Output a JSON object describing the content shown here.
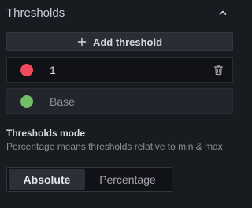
{
  "section": {
    "title": "Thresholds",
    "collapse_icon": "chevron-up-icon"
  },
  "add_button": {
    "label": "Add threshold",
    "icon": "plus-icon"
  },
  "thresholds": [
    {
      "color": "#f2495c",
      "value": "1",
      "deletable": true,
      "delete_icon": "trash-icon"
    },
    {
      "color": "#73bf69",
      "value": "Base",
      "deletable": false
    }
  ],
  "mode": {
    "title": "Thresholds mode",
    "description": "Percentage means thresholds relative to min & max",
    "options": [
      "Absolute",
      "Percentage"
    ],
    "selected": "Absolute"
  },
  "colors": {
    "background": "#181b1f",
    "text": "#ccccdc",
    "muted": "#8e8e94"
  }
}
